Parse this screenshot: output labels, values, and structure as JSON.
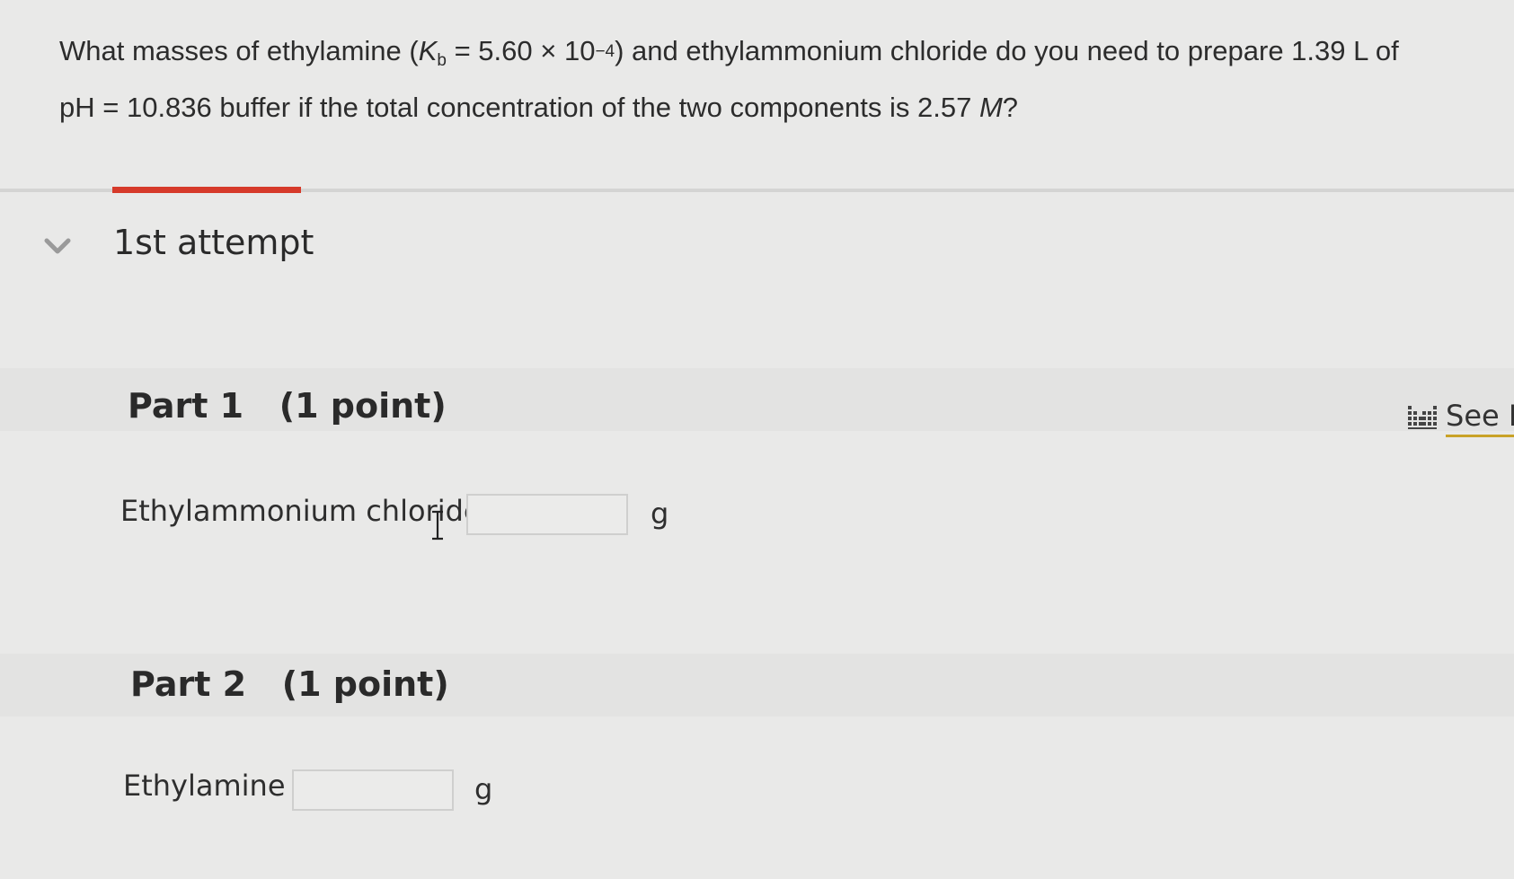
{
  "question": {
    "part1": "What masses of ethylamine (",
    "kb_symbol": "K",
    "kb_sub": "b",
    "kb_value": " = 5.60 × 10",
    "kb_exp": "−4",
    "part2": ") and ethylammonium chloride do you need to prepare 1.39 L of pH = 10.836 buffer if the total concentration of the two components is 2.57 ",
    "unit_M": "M",
    "qmark": "?"
  },
  "attempt": {
    "title": "1st attempt"
  },
  "part1": {
    "title": "Part 1   (1 point)",
    "field_label": "Ethylammonium chloride",
    "value": "",
    "unit": "g"
  },
  "part2": {
    "title": "Part 2   (1 point)",
    "field_label": "Ethylamine",
    "value": "",
    "unit": "g"
  },
  "periodic": {
    "label": "See P"
  },
  "colors": {
    "accent": "#d63a2a",
    "link_underline": "#c9a227",
    "background": "#e9e9e8"
  }
}
